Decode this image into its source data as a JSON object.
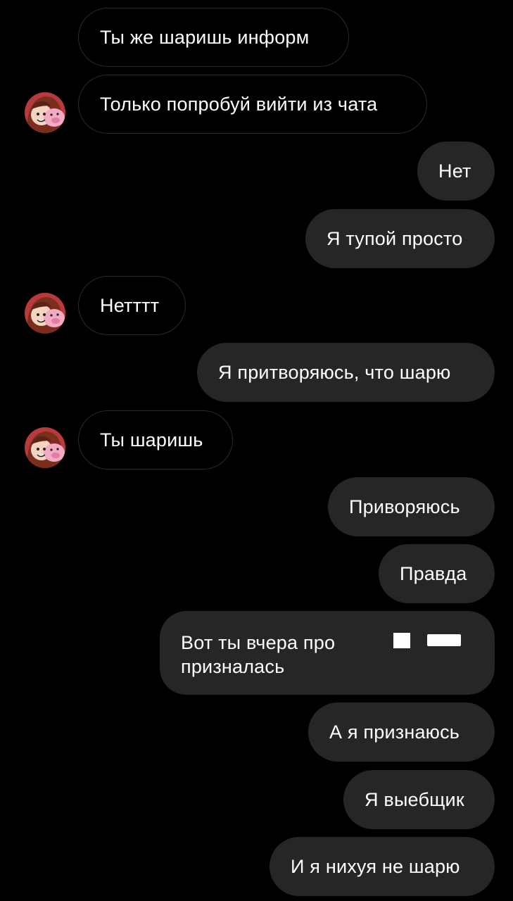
{
  "messages": [
    {
      "text": "Ты же шаришь информ"
    },
    {
      "text": "Только попробуй вийти из чата"
    },
    {
      "text": "Нет"
    },
    {
      "text": "Я тупой просто"
    },
    {
      "text": "Нетттт"
    },
    {
      "text": "Я притворяюсь, что шарю"
    },
    {
      "text": "Ты шаришь"
    },
    {
      "text": "Приворяюсь"
    },
    {
      "text": "Правда"
    },
    {
      "line1": "Вот ты вчера про",
      "line2": "призналась"
    },
    {
      "text": "А я признаюсь"
    },
    {
      "text": "Я выебщик"
    },
    {
      "text": "И я нихуя не шарю"
    }
  ],
  "colors": {
    "background": "#000000",
    "outgoing_bubble": "#262626",
    "incoming_border": "#2b2b2b",
    "text": "#ffffff"
  },
  "avatar_icon": "cartoon-girl-with-pig-avatar"
}
